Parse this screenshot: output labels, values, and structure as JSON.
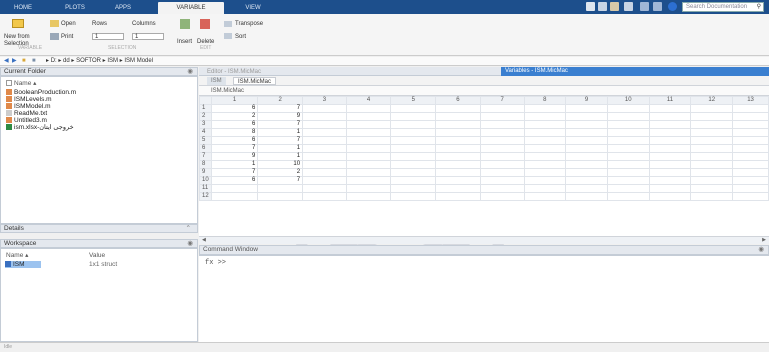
{
  "tabs": [
    "HOME",
    "PLOTS",
    "APPS",
    "VARIABLE",
    "VIEW"
  ],
  "active_tab": 3,
  "search": {
    "placeholder": "Search Documentation"
  },
  "toolstrip": {
    "new_from_selection": "New from Selection",
    "open": "Open",
    "print": "Print",
    "rows": "Rows",
    "columns": "Columns",
    "rows_value": "1",
    "columns_value": "1",
    "insert": "Insert",
    "delete": "Delete",
    "transpose": "Transpose",
    "sort": "Sort",
    "section_variable": "VARIABLE",
    "section_selection": "SELECTION",
    "section_edit": "EDIT"
  },
  "address": [
    "D:",
    "dd",
    "SOFTOR",
    "ISM",
    "ISM Model"
  ],
  "current_folder": {
    "title": "Current Folder",
    "column": "Name",
    "files": [
      {
        "name": "BooleanProduction.m",
        "icon": "m-file-icon"
      },
      {
        "name": "ISMLevels.m",
        "icon": "m-file-icon"
      },
      {
        "name": "ISMModel.m",
        "icon": "m-file-icon"
      },
      {
        "name": "ReadMe.txt",
        "icon": "text-file-icon"
      },
      {
        "name": "Untitled3.m",
        "icon": "m-file-icon"
      },
      {
        "name": "ism.xlsx-خروجی ایتان",
        "icon": "excel-file-icon"
      }
    ]
  },
  "details": {
    "title": "Details"
  },
  "workspace": {
    "title": "Workspace",
    "col_name": "Name",
    "col_value": "Value",
    "rows": [
      {
        "name": "ISM",
        "value": "1x1 struct"
      }
    ]
  },
  "editor": {
    "title": "Editor - ISM.MicMac",
    "variables_title": "Variables - ISM.MicMac",
    "tab_parent": "ISM",
    "tab_active": "ISM.MicMac",
    "breadcrumb": "ISM.MicMac",
    "columns": [
      "1",
      "2",
      "3",
      "4",
      "5",
      "6",
      "7",
      "8",
      "9",
      "10",
      "11",
      "12",
      "13"
    ],
    "rows": [
      {
        "n": "1",
        "c1": "6",
        "c2": "7"
      },
      {
        "n": "2",
        "c1": "2",
        "c2": "9"
      },
      {
        "n": "3",
        "c1": "6",
        "c2": "7"
      },
      {
        "n": "4",
        "c1": "8",
        "c2": "1"
      },
      {
        "n": "5",
        "c1": "6",
        "c2": "7"
      },
      {
        "n": "6",
        "c1": "7",
        "c2": "1"
      },
      {
        "n": "7",
        "c1": "9",
        "c2": "1"
      },
      {
        "n": "8",
        "c1": "1",
        "c2": "10"
      },
      {
        "n": "9",
        "c1": "7",
        "c2": "2"
      },
      {
        "n": "10",
        "c1": "6",
        "c2": "7"
      },
      {
        "n": "11",
        "c1": "",
        "c2": ""
      },
      {
        "n": "12",
        "c1": "",
        "c2": ""
      }
    ]
  },
  "command_window": {
    "title": "Command Window",
    "prompt": "fx >>"
  },
  "status": "Idle",
  "colors": {
    "titlebar": "#1d4f8c",
    "accent": "#3a7fd0"
  }
}
